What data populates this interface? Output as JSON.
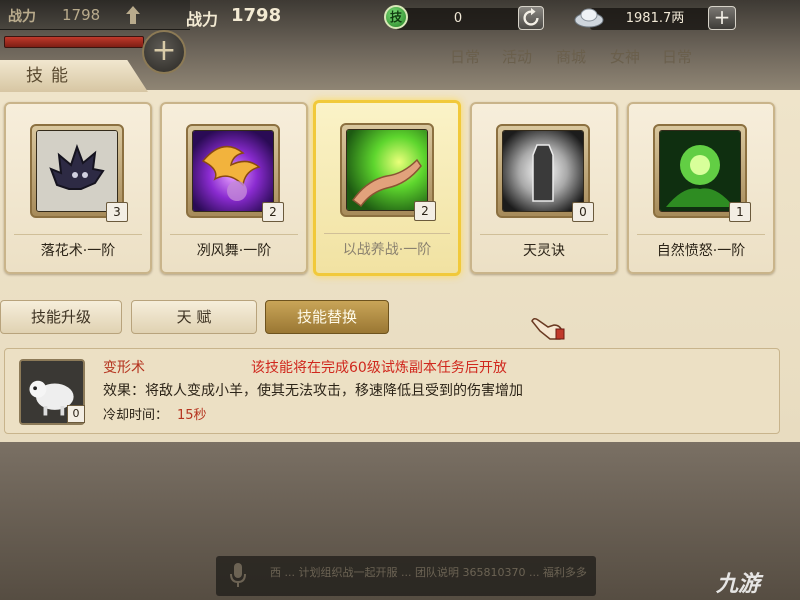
{
  "hud": {
    "left_power_label": "战力",
    "left_power_value": "1798",
    "power_label": "战力",
    "power_value": "1798",
    "badge_label": "技",
    "currency_1": "0",
    "currency_2": "1981.7两",
    "nav": [
      "日常",
      "活动",
      "商城",
      "女神",
      "日常"
    ]
  },
  "panel": {
    "title": "技能"
  },
  "skills": [
    {
      "name": "落花术·一阶",
      "level": "3"
    },
    {
      "name": "冽风舞·一阶",
      "level": "2"
    },
    {
      "name": "以战养战·一阶",
      "level": "2"
    },
    {
      "name": "天灵诀",
      "level": "0"
    },
    {
      "name": "自然愤怒·一阶",
      "level": "1"
    }
  ],
  "tabs": [
    "技能升级",
    "天  赋",
    "技能替换"
  ],
  "detail": {
    "name": "变形术",
    "unlock": "该技能将在完成60级试炼副本任务后开放",
    "effect": "效果：将敌人变成小羊，使其无法攻击，移速降低且受到的伤害增加",
    "cooldown_label": "冷却时间：",
    "cooldown_value": "15秒",
    "level": "0"
  },
  "chat": {
    "text": "西 ... 计划组织战一起开服 ... 团队说明 365810370 ... 福利多多"
  },
  "watermark": "九游",
  "colors": {
    "accent_gold": "#f1c93a",
    "warning_red": "#d0281e",
    "panel_beige": "#efe4ca"
  }
}
